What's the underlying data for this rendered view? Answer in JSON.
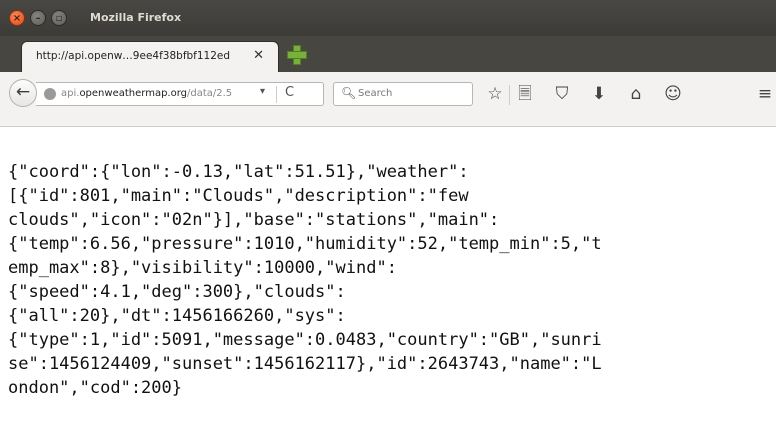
{
  "window": {
    "title": "Mozilla Firefox",
    "close_glyph": "×",
    "min_glyph": "–",
    "max_glyph": "▫"
  },
  "tab": {
    "title": "http://api.openw…9ee4f38bfbf112ed",
    "close_glyph": "✕"
  },
  "navbar": {
    "back_glyph": "←",
    "url_prefix": "api.",
    "url_host": "openweathermap.org",
    "url_path": "/data/2.5",
    "url_dropdown_glyph": "▾",
    "reload_glyph": "C",
    "search_placeholder": "Search",
    "icons": [
      {
        "name": "bookmark-star-icon",
        "glyph": "☆"
      },
      {
        "name": "reading-list-icon",
        "glyph": "🗏"
      },
      {
        "name": "pocket-icon",
        "glyph": "⛉"
      },
      {
        "name": "download-icon",
        "glyph": "⬇"
      },
      {
        "name": "home-icon",
        "glyph": "⌂"
      },
      {
        "name": "hello-chat-icon",
        "glyph": "☺"
      },
      {
        "name": "menu-icon",
        "glyph": "≡"
      }
    ]
  },
  "page": {
    "lines": [
      "{\"coord\":{\"lon\":-0.13,\"lat\":51.51},\"weather\":",
      "[{\"id\":801,\"main\":\"Clouds\",\"description\":\"few",
      "clouds\",\"icon\":\"02n\"}],\"base\":\"stations\",\"main\":",
      "{\"temp\":6.56,\"pressure\":1010,\"humidity\":52,\"temp_min\":5,\"t",
      "emp_max\":8},\"visibility\":10000,\"wind\":",
      "{\"speed\":4.1,\"deg\":300},\"clouds\":",
      "{\"all\":20},\"dt\":1456166260,\"sys\":",
      "{\"type\":1,\"id\":5091,\"message\":0.0483,\"country\":\"GB\",\"sunri",
      "se\":1456124409,\"sunset\":1456162117},\"id\":2643743,\"name\":\"L",
      "ondon\",\"cod\":200}"
    ]
  }
}
